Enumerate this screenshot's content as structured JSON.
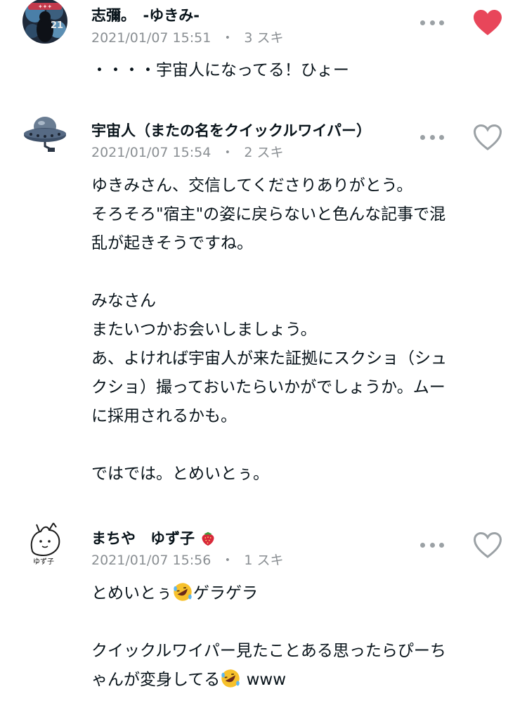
{
  "comments": [
    {
      "author": "志彌。　-ゆきみ-",
      "date": "2021/01/07 15:51",
      "separator": "・",
      "likes": "3 スキ",
      "liked": true,
      "lines": [
        "・・・・宇宙人になってる！ひょー"
      ]
    },
    {
      "author": "宇宙人（またの名をクイックルワイパー）",
      "date": "2021/01/07 15:54",
      "separator": "・",
      "likes": "2 スキ",
      "liked": false,
      "lines": [
        "ゆきみさん、交信してくださりありがとう。",
        "そろそろ\"宿主\"の姿に戻らないと色んな記事で混",
        "乱が起きそうですね。",
        "",
        "みなさん",
        "またいつかお会いしましょう。",
        "あ、よければ宇宙人が来た証拠にスクショ（シュ",
        "クショ）撮っておいたらいかがでしょうか。ムー",
        "に採用されるかも。",
        "",
        "ではでは。とめいとぅ。"
      ]
    },
    {
      "author": "まちや　ゆず子",
      "date": "2021/01/07 15:56",
      "separator": "・",
      "likes": "1 スキ",
      "liked": false,
      "line1_a": "とめいとぅ",
      "line1_b": "ゲラゲラ",
      "line2": "",
      "line3": "クイックルワイパー見たことある思ったらぴーち",
      "line4_a": "ゃんが変身してる",
      "line4_b": " www",
      "avatar_text": "ゆず子"
    }
  ],
  "colors": {
    "heart_liked": "#e8465a",
    "heart_outline": "#9ba1a5",
    "meta_text": "#8a8f93",
    "body_text": "#08131a"
  },
  "icons": {
    "more": "more-horizontal-icon",
    "like": "heart-icon",
    "emoji": "rofl-emoji-icon",
    "strawberry": "strawberry-emoji-icon"
  }
}
